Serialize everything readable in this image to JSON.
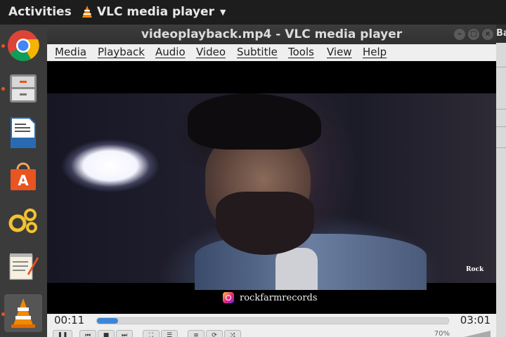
{
  "topbar": {
    "activities_label": "Activities",
    "app_menu_label": "VLC media player"
  },
  "dock": {
    "items": [
      {
        "name": "Chromium Web Browser",
        "icon": "chrome-icon",
        "running": true
      },
      {
        "name": "Files",
        "icon": "file-cabinet-icon",
        "running": true
      },
      {
        "name": "LibreOffice Writer",
        "icon": "document-icon",
        "running": false
      },
      {
        "name": "Ubuntu Software",
        "icon": "shopping-bag-icon",
        "running": false
      },
      {
        "name": "Settings",
        "icon": "gears-icon",
        "running": false
      },
      {
        "name": "Text Editor",
        "icon": "notepad-icon",
        "running": false
      },
      {
        "name": "VLC media player",
        "icon": "vlc-cone-icon",
        "running": true
      }
    ]
  },
  "background_window": {
    "title_fragment": "Ba"
  },
  "window": {
    "title": "videoplayback.mp4 - VLC media player",
    "buttons": [
      "minimize",
      "maximize",
      "close"
    ]
  },
  "menubar": {
    "items": [
      "Media",
      "Playback",
      "Audio",
      "Video",
      "Subtitle",
      "Tools",
      "View",
      "Help"
    ]
  },
  "video": {
    "watermark": "rockfarmrecords",
    "corner_logo": "Rock"
  },
  "playback": {
    "elapsed": "00:11",
    "total": "03:01",
    "progress_fraction": 0.06,
    "volume_label": "70%"
  },
  "colors": {
    "accent": "#3c86d8",
    "dock_indicator": "#e95420",
    "topbar_bg": "#1d1d1d",
    "titlebar_bg": "#353535"
  }
}
